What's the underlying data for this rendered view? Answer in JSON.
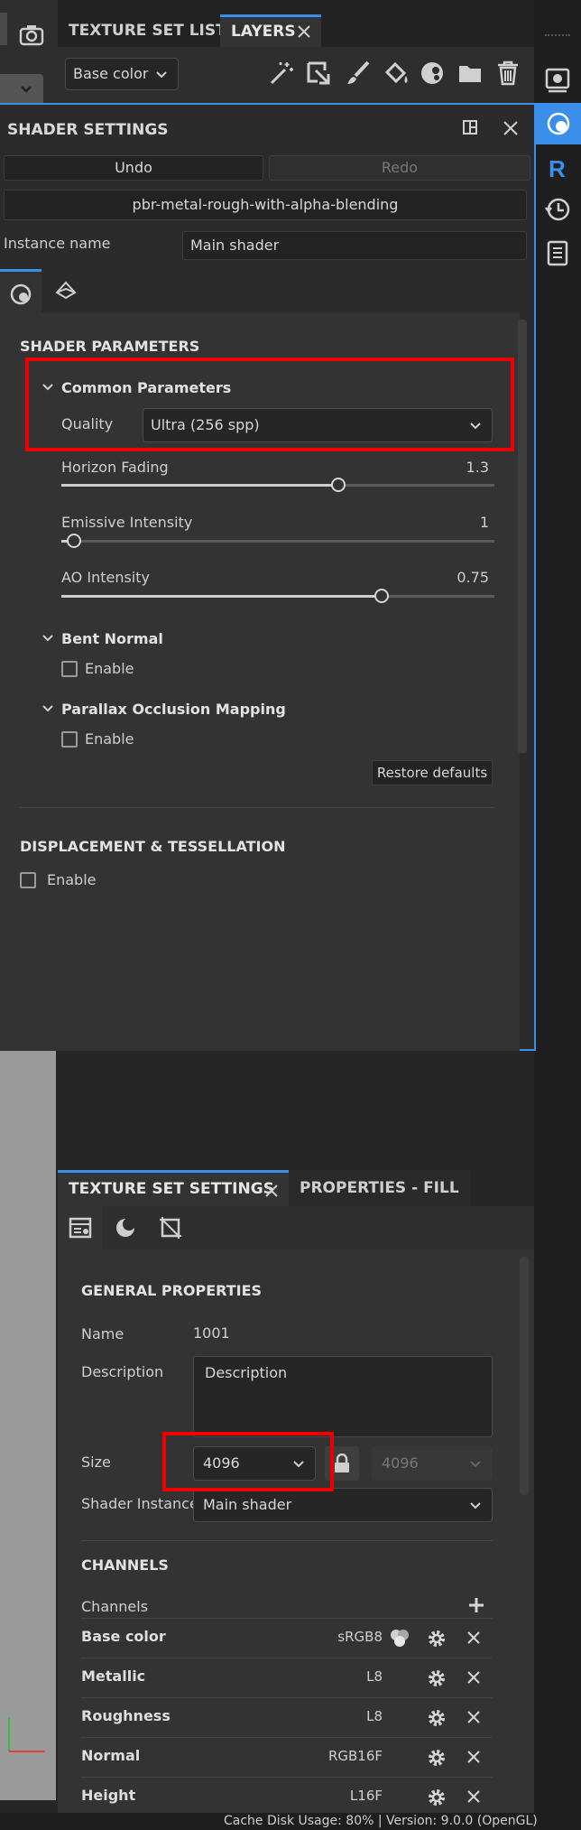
{
  "top": {
    "tabs": [
      "TEXTURE SET LIST",
      "LAYERS"
    ],
    "channel_select": "Base color"
  },
  "shader_settings": {
    "title": "SHADER SETTINGS",
    "undo": "Undo",
    "redo": "Redo",
    "shader_name": "pbr-metal-rough-with-alpha-blending",
    "instance_label": "Instance name",
    "instance_value": "Main shader",
    "params_title": "SHADER PARAMETERS",
    "common_title": "Common Parameters",
    "quality_label": "Quality",
    "quality_value": "Ultra (256 spp)",
    "sliders": [
      {
        "label": "Horizon Fading",
        "value": "1.3",
        "level": 0.64
      },
      {
        "label": "Emissive Intensity",
        "value": "1",
        "level": 0.03
      },
      {
        "label": "AO Intensity",
        "value": "0.75",
        "level": 0.74
      }
    ],
    "bent_normal_title": "Bent Normal",
    "bent_enable": "Enable",
    "pom_title": "Parallax Occlusion Mapping",
    "pom_enable": "Enable",
    "restore": "Restore defaults",
    "disp_title": "DISPLACEMENT & TESSELLATION",
    "disp_enable": "Enable"
  },
  "texture_set": {
    "tabs": [
      "TEXTURE SET SETTINGS",
      "PROPERTIES - FILL"
    ],
    "general_title": "GENERAL PROPERTIES",
    "name_label": "Name",
    "name_value": "1001",
    "desc_label": "Description",
    "desc_value": "Description",
    "size_label": "Size",
    "size_value": "4096",
    "size_value2": "4096",
    "shader_label": "Shader Instance",
    "shader_value": "Main shader",
    "channels_title": "CHANNELS",
    "channels_label": "Channels",
    "channels": [
      {
        "name": "Base color",
        "format": "sRGB8"
      },
      {
        "name": "Metallic",
        "format": "L8"
      },
      {
        "name": "Roughness",
        "format": "L8"
      },
      {
        "name": "Normal",
        "format": "RGB16F"
      },
      {
        "name": "Height",
        "format": "L16F"
      }
    ]
  },
  "status": {
    "text": "Cache Disk Usage:    80% | Version: 9.0.0 (OpenGL)"
  },
  "colors": {
    "accent": "#3b8eea",
    "highlight": "#e00000",
    "remove": "#d6d6d6"
  }
}
